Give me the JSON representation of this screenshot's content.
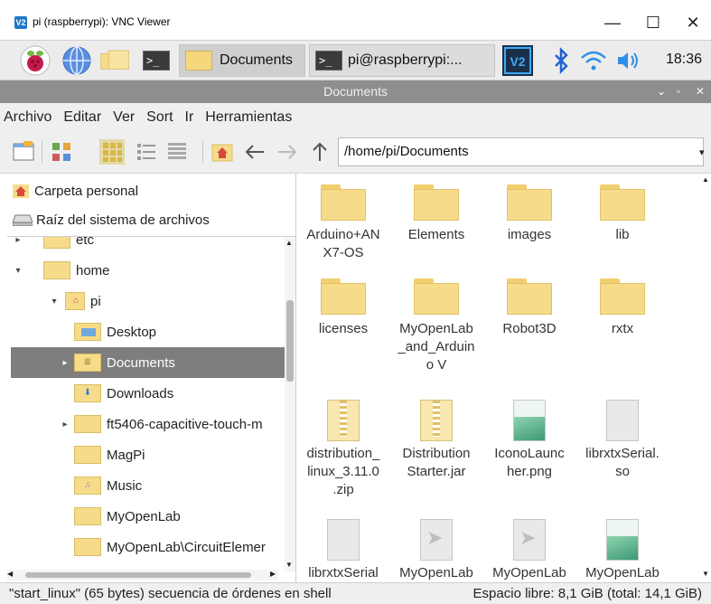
{
  "vnc": {
    "logo": "V2",
    "title": "pi (raspberrypi): VNC Viewer",
    "minimize": "—",
    "maximize": "☐",
    "close": "✕"
  },
  "panel": {
    "tasks": [
      {
        "label": "Documents",
        "kind": "folder"
      },
      {
        "label": "pi@raspberrypi:...",
        "kind": "terminal"
      }
    ],
    "terminal_glyph": ">_",
    "clock": "18:36",
    "tray_icons": [
      "vnc-icon",
      "bluetooth-icon",
      "wifi-icon",
      "volume-icon"
    ]
  },
  "filemanager": {
    "title": "Documents",
    "title_controls": [
      "⌄",
      "▫",
      "✕"
    ],
    "menu": [
      "Archivo",
      "Editar",
      "Ver",
      "Sort",
      "Ir",
      "Herramientas"
    ],
    "path": "/home/pi/Documents",
    "places": [
      {
        "label": "Carpeta personal",
        "icon": "home-icon"
      },
      {
        "label": "Raíz del sistema de archivos",
        "icon": "drive-icon"
      }
    ],
    "tree": [
      {
        "label": "etc",
        "depth": 0,
        "expander": "▸",
        "badge": ""
      },
      {
        "label": "home",
        "depth": 0,
        "expander": "▾",
        "badge": ""
      },
      {
        "label": "pi",
        "depth": 1,
        "expander": "▾",
        "badge": "🏠"
      },
      {
        "label": "Desktop",
        "depth": 2,
        "expander": "",
        "badge": "▭"
      },
      {
        "label": "Documents",
        "depth": 2,
        "expander": "▸",
        "badge": "≣",
        "selected": true
      },
      {
        "label": "Downloads",
        "depth": 2,
        "expander": "",
        "badge": "⬇"
      },
      {
        "label": "ft5406-capacitive-touch-m",
        "depth": 2,
        "expander": "▸",
        "badge": ""
      },
      {
        "label": "MagPi",
        "depth": 2,
        "expander": "",
        "badge": ""
      },
      {
        "label": "Music",
        "depth": 2,
        "expander": "",
        "badge": "♫"
      },
      {
        "label": "MyOpenLab",
        "depth": 2,
        "expander": "",
        "badge": ""
      },
      {
        "label": "MyOpenLab\\CircuitElemer",
        "depth": 2,
        "expander": "",
        "badge": ""
      }
    ],
    "items": [
      {
        "name": "Arduino+ANX7-OS",
        "lines": [
          "Arduino+AN",
          "X7-OS"
        ],
        "type": "folder"
      },
      {
        "name": "Elements",
        "lines": [
          "Elements"
        ],
        "type": "folder"
      },
      {
        "name": "images",
        "lines": [
          "images"
        ],
        "type": "folder"
      },
      {
        "name": "lib",
        "lines": [
          "lib"
        ],
        "type": "folder"
      },
      {
        "name": "licenses",
        "lines": [
          "licenses"
        ],
        "type": "folder"
      },
      {
        "name": "MyOpenLab_and_ArduinoV",
        "lines": [
          "MyOpenLab",
          "_and_Arduin",
          "o V"
        ],
        "type": "folder"
      },
      {
        "name": "Robot3D",
        "lines": [
          "Robot3D"
        ],
        "type": "folder"
      },
      {
        "name": "rxtx",
        "lines": [
          "rxtx"
        ],
        "type": "folder"
      },
      {
        "name": "distribution_linux_3.11.0.zip",
        "lines": [
          "distribution_",
          "linux_3.11.0",
          ".zip"
        ],
        "type": "zip"
      },
      {
        "name": "DistributionStarter.jar",
        "lines": [
          "Distribution",
          "Starter.jar"
        ],
        "type": "zip"
      },
      {
        "name": "IconoLauncher.png",
        "lines": [
          "IconoLaunc",
          "her.png"
        ],
        "type": "image"
      },
      {
        "name": "librxtxSerial.so",
        "lines": [
          "librxtxSerial.",
          "so"
        ],
        "type": "generic"
      },
      {
        "name": "librxtxSerial",
        "lines": [
          "librxtxSerial"
        ],
        "type": "generic"
      },
      {
        "name": "MyOpenLab",
        "lines": [
          "MyOpenLab"
        ],
        "type": "plane"
      },
      {
        "name": "MyOpenLab",
        "lines": [
          "MyOpenLab"
        ],
        "type": "plane"
      },
      {
        "name": "MyOpenLab",
        "lines": [
          "MyOpenLab"
        ],
        "type": "image"
      }
    ],
    "status_left": "\"start_linux\" (65 bytes) secuencia de órdenes en shell",
    "status_right": "Espacio libre: 8,1 GiB (total: 14,1 GiB)"
  }
}
